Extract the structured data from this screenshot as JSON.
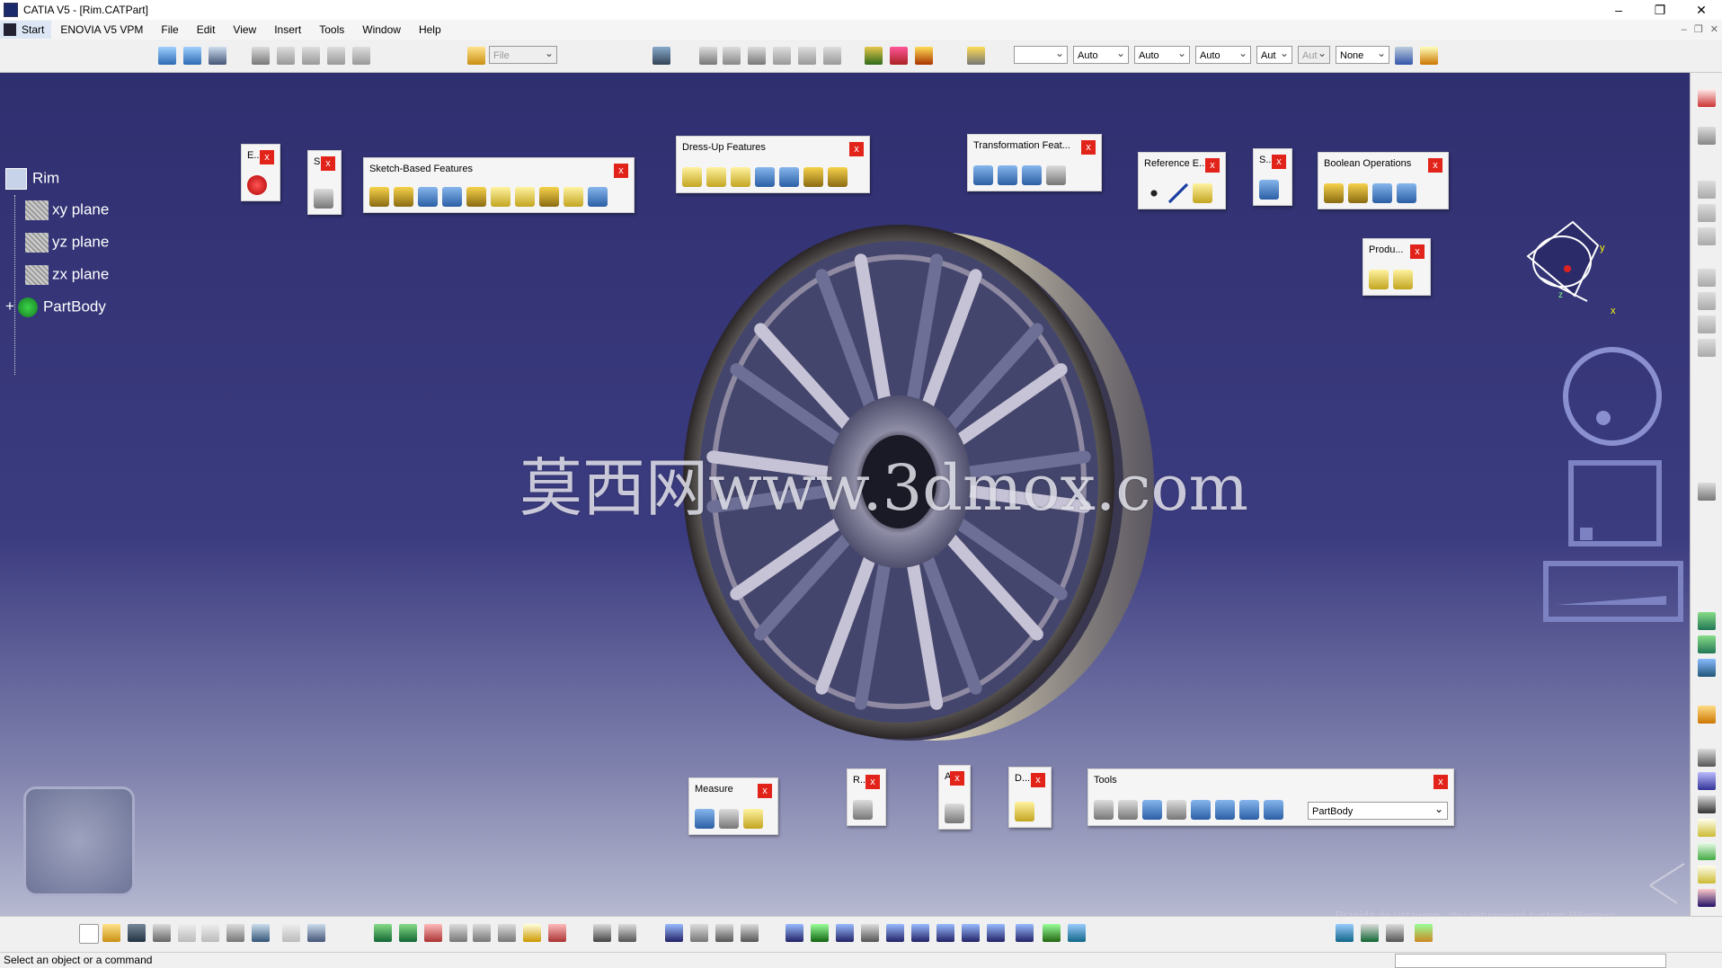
{
  "window": {
    "title": "CATIA V5 - [Rim.CATPart]"
  },
  "menu": {
    "start": "Start",
    "items": [
      "ENOVIA V5 VPM",
      "File",
      "Edit",
      "View",
      "Insert",
      "Tools",
      "Window",
      "Help"
    ]
  },
  "toolbar": {
    "file_combo": "File",
    "combos": [
      "",
      "Auto",
      "Auto",
      "Auto",
      "Aut",
      "Aut",
      "None"
    ]
  },
  "tree": {
    "root": "Rim",
    "planes": [
      "xy plane",
      "yz plane",
      "zx plane"
    ],
    "body": "PartBody"
  },
  "panels": {
    "exit": "E...",
    "sketcher": "S",
    "sketch_based": "Sketch-Based Features",
    "dress_up": "Dress-Up Features",
    "transformation": "Transformation Feat...",
    "reference": "Reference E...",
    "surface": "S...",
    "boolean": "Boolean Operations",
    "product": "Produ...",
    "measure": "Measure",
    "render": "R...",
    "annotation": "A",
    "drafting": "D...",
    "tools": "Tools",
    "tools_combo": "PartBody",
    "close_glyph": "x"
  },
  "viewport": {
    "watermark": "莫西网www.3dmox.com",
    "activate_windows": "Przejdź do ustawień, aby aktywować system Windows.",
    "compass": {
      "x": "x",
      "y": "y",
      "z": "z"
    }
  },
  "status": {
    "message": "Select an object or a command"
  },
  "colors": {
    "background_top": "#2f2f70",
    "background_bottom": "#b6b9d0",
    "close": "#e2231a"
  }
}
